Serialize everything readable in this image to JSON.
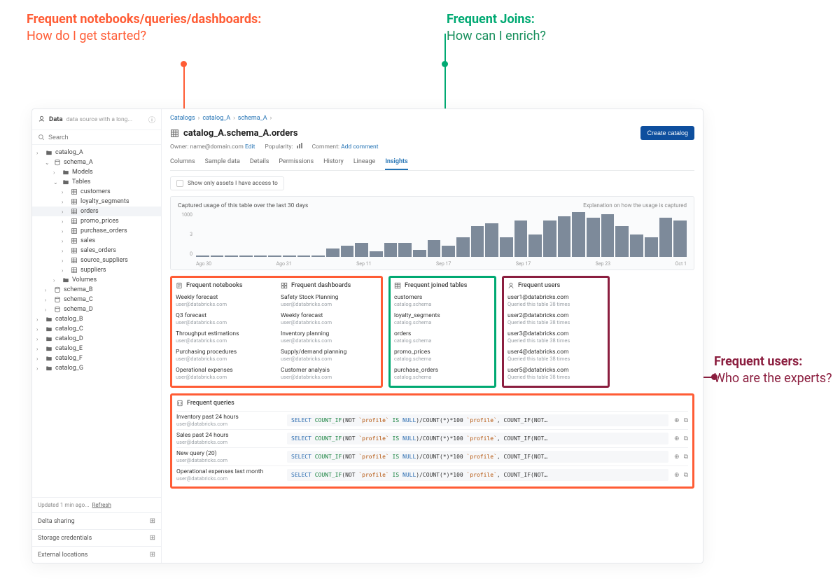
{
  "annotations": {
    "orange": {
      "title": "Frequent notebooks/queries/dashboards:",
      "sub": "How do I get started?"
    },
    "green": {
      "title": "Frequent Joins:",
      "sub": "How can I enrich?"
    },
    "maroon": {
      "title": "Frequent users:",
      "sub": "Who are the experts?"
    }
  },
  "sidebar": {
    "title": "Data",
    "desc": "data source with a long...",
    "search_placeholder": "Search",
    "updated": "Updated 1 min ago...",
    "refresh": "Refresh",
    "footer": [
      {
        "label": "Delta sharing"
      },
      {
        "label": "Storage credentials"
      },
      {
        "label": "External locations"
      }
    ],
    "tree": [
      {
        "label": "catalog_A",
        "icon": "folder",
        "depth": 0,
        "chev": "›",
        "children": [
          {
            "label": "schema_A",
            "icon": "schema",
            "depth": 1,
            "chev": "⌄",
            "children": [
              {
                "label": "Models",
                "icon": "folder",
                "depth": 2,
                "chev": "›"
              },
              {
                "label": "Tables",
                "icon": "folder",
                "depth": 2,
                "chev": "⌄",
                "children": [
                  {
                    "label": "customers",
                    "icon": "table",
                    "depth": 3,
                    "chev": "›"
                  },
                  {
                    "label": "loyalty_segments",
                    "icon": "table",
                    "depth": 3,
                    "chev": "›"
                  },
                  {
                    "label": "orders",
                    "icon": "table",
                    "depth": 3,
                    "chev": "›",
                    "selected": true
                  },
                  {
                    "label": "promo_prices",
                    "icon": "table",
                    "depth": 3,
                    "chev": "›"
                  },
                  {
                    "label": "purchase_orders",
                    "icon": "table",
                    "depth": 3,
                    "chev": "›"
                  },
                  {
                    "label": "sales",
                    "icon": "table",
                    "depth": 3,
                    "chev": "›"
                  },
                  {
                    "label": "sales_orders",
                    "icon": "table",
                    "depth": 3,
                    "chev": "›"
                  },
                  {
                    "label": "source_suppliers",
                    "icon": "table",
                    "depth": 3,
                    "chev": "›"
                  },
                  {
                    "label": "suppliers",
                    "icon": "table",
                    "depth": 3,
                    "chev": "›"
                  }
                ]
              },
              {
                "label": "Volumes",
                "icon": "folder",
                "depth": 2,
                "chev": "›"
              }
            ]
          },
          {
            "label": "schema_B",
            "icon": "schema",
            "depth": 1,
            "chev": "›"
          },
          {
            "label": "schema_C",
            "icon": "schema",
            "depth": 1,
            "chev": "›"
          },
          {
            "label": "schema_D",
            "icon": "schema",
            "depth": 1,
            "chev": "›"
          }
        ]
      },
      {
        "label": "catalog_B",
        "icon": "folder",
        "depth": 0,
        "chev": "›"
      },
      {
        "label": "catalog_C",
        "icon": "folder",
        "depth": 0,
        "chev": "›"
      },
      {
        "label": "catalog_D",
        "icon": "folder",
        "depth": 0,
        "chev": "›"
      },
      {
        "label": "catalog_E",
        "icon": "folder",
        "depth": 0,
        "chev": "›"
      },
      {
        "label": "catalog_F",
        "icon": "folder",
        "depth": 0,
        "chev": "›"
      },
      {
        "label": "catalog_G",
        "icon": "folder",
        "depth": 0,
        "chev": "›"
      }
    ]
  },
  "breadcrumb": [
    "Catalogs",
    "catalog_A",
    "schema_A"
  ],
  "page_title": "catalog_A.schema_A.orders",
  "create_button": "Create catalog",
  "meta": {
    "owner_label": "Owner:",
    "owner": "name@domain.com",
    "edit": "Edit",
    "popularity_label": "Popularity:",
    "comment_label": "Comment:",
    "add_comment": "Add comment"
  },
  "tabs": [
    "Columns",
    "Sample data",
    "Details",
    "Permissions",
    "History",
    "Lineage",
    "Insights"
  ],
  "active_tab": "Insights",
  "checkbox_label": "Show only assets I have access to",
  "chart": {
    "title": "Captured usage of this table over the last 30 days",
    "explanation": "Explanation on how the usage is captured"
  },
  "chart_data": {
    "type": "bar",
    "title": "Captured usage of this table over the last 30 days",
    "ylabel": "",
    "yticks": [
      0,
      3,
      1000
    ],
    "xticks": [
      "Ago 30",
      "Ago 31",
      "Sep 11",
      "Sep 17",
      "Sep 17",
      "Sep 23",
      "Oct 1"
    ],
    "values": [
      20,
      20,
      20,
      20,
      20,
      20,
      20,
      20,
      20,
      150,
      200,
      250,
      100,
      250,
      250,
      120,
      300,
      200,
      350,
      550,
      600,
      350,
      650,
      400,
      650,
      720,
      800,
      700,
      760,
      550,
      400,
      350,
      700,
      650
    ]
  },
  "cards": {
    "notebooks": {
      "title": "Frequent notebooks",
      "items": [
        {
          "t": "Weekly forecast",
          "s": "user@databricks.com"
        },
        {
          "t": "Q3 forecast",
          "s": "user@databricks.com"
        },
        {
          "t": "Throughput estimations",
          "s": "user@databricks.com"
        },
        {
          "t": "Purchasing procedures",
          "s": "user@databricks.com"
        },
        {
          "t": "Operational expenses",
          "s": "user@databricks.com"
        }
      ]
    },
    "dashboards": {
      "title": "Frequent dashboards",
      "items": [
        {
          "t": "Safety Stock Planning",
          "s": "user@databricks.com"
        },
        {
          "t": "Weekly forecast",
          "s": "user@databricks.com"
        },
        {
          "t": "Inventory planning",
          "s": "user@databricks.com"
        },
        {
          "t": "Supply/demand planning",
          "s": "user@databricks.com"
        },
        {
          "t": "Customer analysis",
          "s": "user@databricks.com"
        }
      ]
    },
    "joins": {
      "title": "Frequent joined tables",
      "items": [
        {
          "t": "customers",
          "s": "catalog.schema"
        },
        {
          "t": "loyalty_segments",
          "s": "catalog.schema"
        },
        {
          "t": "orders",
          "s": "catalog.schema"
        },
        {
          "t": "promo_prices",
          "s": "catalog.schema"
        },
        {
          "t": "purchase_orders",
          "s": "catalog.schema"
        }
      ]
    },
    "users": {
      "title": "Frequent users",
      "items": [
        {
          "t": "user1@databricks.com",
          "s": "Queried this table 38 times"
        },
        {
          "t": "user2@databricks.com",
          "s": "Queried this table 38 times"
        },
        {
          "t": "user3@databricks.com",
          "s": "Queried this table 38 times"
        },
        {
          "t": "user4@databricks.com",
          "s": "Queried this table 38 times"
        },
        {
          "t": "user5@databricks.com",
          "s": "Queried this table 38 times"
        }
      ]
    }
  },
  "queries": {
    "title": "Frequent queries",
    "sql_parts": {
      "kw1": "SELECT",
      "fn1": "COUNT_IF",
      "lit_not": "NOT",
      "str1": "`profile`",
      "fn2": "IS",
      "kw2": "NULL",
      "rest": ")/COUNT(*)*100",
      "str2": "`profile`",
      "tail": ", COUNT_IF(NOT…"
    },
    "items": [
      {
        "t": "Inventory past 24 hours",
        "s": "user@databricks.com"
      },
      {
        "t": "Sales past 24 hours",
        "s": "user@databricks.com"
      },
      {
        "t": "New query (20)",
        "s": "user@databricks.com"
      },
      {
        "t": "Operational expenses last month",
        "s": "user@databricks.com"
      }
    ]
  }
}
